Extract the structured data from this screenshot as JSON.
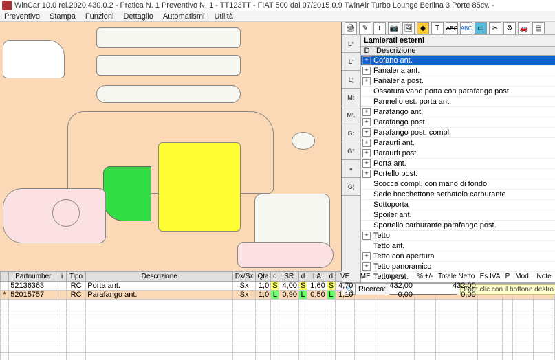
{
  "title": "WinCar 10.0 rel.2020.430.0.2 - Pratica N. 1 Preventivo N. 1  - TT123TT - FIAT 500 dal 07/2015 0.9 TwinAir Turbo Lounge Berlina 3 Porte 85cv. -",
  "menu": [
    "Preventivo",
    "Stampa",
    "Funzioni",
    "Dettaglio",
    "Automatismi",
    "Utilità"
  ],
  "toolbar_icons": [
    "print",
    "pencil",
    "bold",
    "camera",
    "photo",
    "warning",
    "text",
    "abc-strike",
    "abc-blue",
    "blue-box",
    "scissors",
    "gear",
    "car-red",
    "sheet",
    "exit"
  ],
  "tree_title": "Lamierati esterni",
  "tree_header": {
    "d": "D",
    "desc": "Descrizione"
  },
  "tree_items": [
    {
      "label": "Cofano ant.",
      "exp": "+",
      "selected": true
    },
    {
      "label": "Fanaleria ant.",
      "exp": "+"
    },
    {
      "label": "Fanaleria post.",
      "exp": "+"
    },
    {
      "label": "Ossatura vano porta con parafango post.",
      "exp": ""
    },
    {
      "label": "Pannello est. porta ant.",
      "exp": ""
    },
    {
      "label": "Parafango ant.",
      "exp": "+"
    },
    {
      "label": "Parafango post.",
      "exp": "+"
    },
    {
      "label": "Parafango post. compl.",
      "exp": "+"
    },
    {
      "label": "Paraurti ant.",
      "exp": "+"
    },
    {
      "label": "Paraurti post.",
      "exp": "+"
    },
    {
      "label": "Porta ant.",
      "exp": "+"
    },
    {
      "label": "Portello post.",
      "exp": "+"
    },
    {
      "label": "Scocca compl. con mano di fondo",
      "exp": ""
    },
    {
      "label": "Sede bocchettone serbatoio carburante",
      "exp": ""
    },
    {
      "label": "Sottoporta",
      "exp": ""
    },
    {
      "label": "Spoiler ant.",
      "exp": ""
    },
    {
      "label": "Sportello carburante parafango post.",
      "exp": ""
    },
    {
      "label": "Tetto",
      "exp": "+"
    },
    {
      "label": "Tetto ant.",
      "exp": ""
    },
    {
      "label": "Tetto con apertura",
      "exp": "+"
    },
    {
      "label": "Tetto panoramico",
      "exp": "+"
    },
    {
      "label": "Tetto post.",
      "exp": ""
    }
  ],
  "sidetabs": [
    "L°",
    "L'",
    "L¦",
    "M:",
    "M'.",
    "G:",
    "G°",
    "●",
    "G¦"
  ],
  "search": {
    "label": "Ricerca:",
    "placeholder": "",
    "hint": "Fare clic con il bottone destro del mouse su Cofano ant."
  },
  "grid": {
    "headers": [
      "",
      "Partnumber",
      "i",
      "Tipo",
      "Descrizione",
      "Dx/Sx",
      "Qta",
      "d",
      "SR",
      "d",
      "LA",
      "d",
      "VE",
      "ME",
      "Importo",
      "% +/-",
      "Totale Netto",
      "Es.IVA",
      "P",
      "Mod.",
      "Note"
    ],
    "widths": [
      12,
      70,
      12,
      28,
      210,
      32,
      22,
      12,
      28,
      12,
      28,
      12,
      28,
      30,
      55,
      30,
      60,
      36,
      14,
      30,
      30
    ],
    "rows": [
      {
        "mark": "",
        "pn": "52136363",
        "i": "",
        "tipo": "RC",
        "desc": "Porta ant.",
        "dxsx": "Sx",
        "qta": "1,0",
        "d1": "S",
        "sr": "4,00",
        "d2": "S",
        "la": "1,60",
        "d3": "S",
        "ve": "4,70",
        "me": "",
        "importo": "432,00",
        "pct": "",
        "netto": "432,00",
        "iva": "",
        "p": "",
        "mod": "",
        "note": "",
        "cls": "row1"
      },
      {
        "mark": "*",
        "pn": "52015757",
        "i": "",
        "tipo": "RC",
        "desc": "Parafango ant.",
        "dxsx": "Sx",
        "qta": "1,0",
        "d1": "L",
        "sr": "0,90",
        "d2": "L",
        "la": "0,50",
        "d3": "L",
        "ve": "1,10",
        "me": "",
        "importo": "0,00",
        "pct": "",
        "netto": "0,00",
        "iva": "",
        "p": "",
        "mod": "",
        "note": "",
        "cls": "row2"
      }
    ]
  }
}
